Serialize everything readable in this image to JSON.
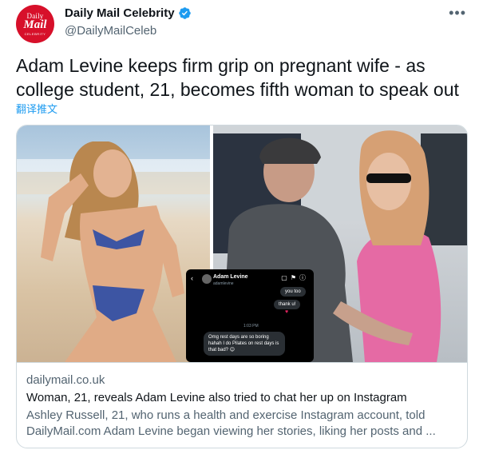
{
  "author": {
    "avatar_line1": "Daily",
    "avatar_line2": "Mail",
    "avatar_line3": "CELEBRITY",
    "display_name": "Daily Mail Celebrity",
    "handle": "@DailyMailCeleb",
    "verified": true
  },
  "menu": {
    "more_label": "•••"
  },
  "tweet": {
    "text": "Adam Levine keeps firm grip on pregnant wife - as college student, 21, becomes fifth woman to speak out",
    "translate_label": "翻译推文"
  },
  "dm": {
    "name": "Adam Levine",
    "handle": "adamlevine",
    "bubble_top": "you too",
    "bubble_thanks": "thank u!",
    "time": "1:03 PM",
    "bubble_message": "Omg rest days are so boring hahah I do Pilates on rest days is that bad? 😊"
  },
  "card": {
    "domain": "dailymail.co.uk",
    "title": "Woman, 21, reveals Adam Levine also tried to chat her up on Instagram",
    "description": "Ashley Russell, 21, who runs a health and exercise Instagram account, told DailyMail.com Adam Levine began viewing her stories, liking her posts and ..."
  },
  "colors": {
    "brand_red": "#d7102a",
    "verified_blue": "#1d9bf0",
    "link_blue": "#1d9bf0",
    "secondary_text": "#536471",
    "border": "#cfd9de"
  }
}
